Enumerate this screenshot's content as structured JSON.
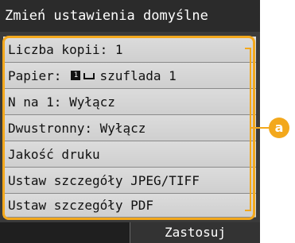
{
  "title": "Zmień ustawienia domyślne",
  "menu_items": [
    {
      "label": "Liczba kopii: 1"
    },
    {
      "label_prefix": "Papier:",
      "paper_badge": "1",
      "label_suffix": "szuflada 1"
    },
    {
      "label": "N na 1: Wyłącz"
    },
    {
      "label": "Dwustronny: Wyłącz"
    },
    {
      "label": "Jakość druku"
    },
    {
      "label": "Ustaw szczegóły JPEG/TIFF"
    },
    {
      "label": "Ustaw szczegóły PDF"
    }
  ],
  "apply_label": "Zastosuj",
  "callout": {
    "label": "a",
    "color": "#f3a81c"
  }
}
